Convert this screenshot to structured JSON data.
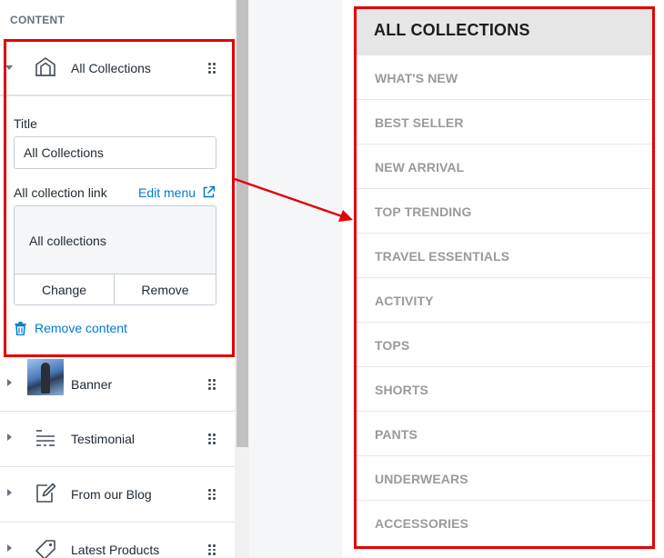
{
  "sidebar": {
    "heading": "CONTENT",
    "expanded_item": {
      "label": "All Collections",
      "icon": "storefront-icon",
      "title_label": "Title",
      "title_value": "All Collections",
      "link_label": "All collection link",
      "edit_menu": "Edit menu",
      "link_value": "All collections",
      "change_label": "Change",
      "remove_label": "Remove",
      "remove_content_label": "Remove content"
    },
    "items": [
      {
        "label": "Banner",
        "icon": "image-thumbnail"
      },
      {
        "label": "Testimonial",
        "icon": "text-lines-icon"
      },
      {
        "label": "From our Blog",
        "icon": "edit-note-icon"
      },
      {
        "label": "Latest Products",
        "icon": "tag-icon"
      }
    ]
  },
  "preview": {
    "title": "ALL COLLECTIONS",
    "items": [
      "WHAT'S NEW",
      "BEST SELLER",
      "NEW ARRIVAL",
      "TOP TRENDING",
      "TRAVEL ESSENTIALS",
      "ACTIVITY",
      "TOPS",
      "SHORTS",
      "PANTS",
      "UNDERWEARS",
      "ACCESSORIES"
    ]
  },
  "colors": {
    "highlight": "#e30000",
    "link": "#007ace",
    "preview_header_bg": "#e6e6e6",
    "preview_item_text": "#9a9a9a"
  }
}
